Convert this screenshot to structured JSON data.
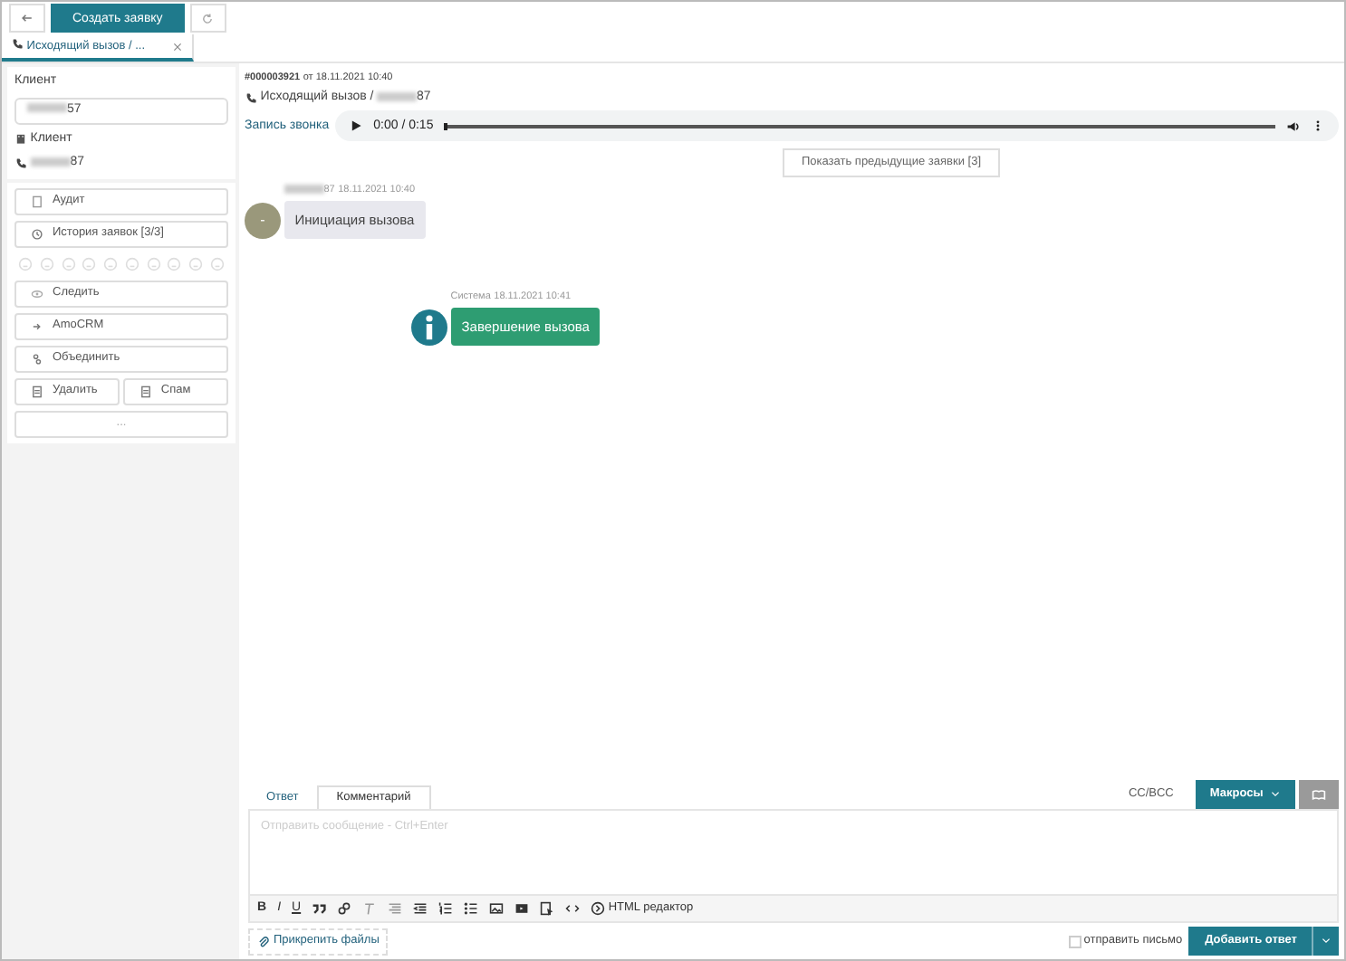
{
  "top_bar": {
    "create_button": "Создать заявку"
  },
  "tabs": [
    {
      "label": "Исходящий вызов / ...",
      "selected": true
    }
  ],
  "client": {
    "title": "Клиент",
    "phone_field": "57",
    "type": "Клиент",
    "phone": "87"
  },
  "actions": [
    {
      "label": "Аудит"
    },
    {
      "label": "История заявок [3/3]"
    }
  ],
  "actions2": [
    {
      "label": "Следить"
    },
    {
      "label": "AmoCRM"
    },
    {
      "label": "Объединить"
    }
  ],
  "split_actions": [
    {
      "label": "Удалить"
    },
    {
      "label": "Спам"
    }
  ],
  "more_button": "...",
  "ticket": {
    "number": "#000003921",
    "date": "от 18.11.2021 10:40",
    "title": "Исходящий вызов /",
    "phone": "87"
  },
  "recording": {
    "label": "Запись звонка",
    "time": "0:00 / 0:15",
    "level": 0
  },
  "previous_button": "Показать предыдущие заявки [3]",
  "messages": [
    {
      "kind": "client",
      "author": "87",
      "time": "18.11.2021 10:40",
      "avatar": "-",
      "text": "Инициация вызова"
    },
    {
      "kind": "system",
      "author": "Система",
      "time": "18.11.2021 10:41",
      "text": "Завершение вызова"
    }
  ],
  "composer": {
    "tabs": [
      {
        "label": "Ответ",
        "selected": false
      },
      {
        "label": "Комментарий",
        "selected": true
      }
    ],
    "format_buttons": [
      "B",
      "I",
      "U"
    ],
    "cc": "CC/BCC",
    "macros": "Макросы",
    "placeholder": "Отправить сообщение - Ctrl+Enter",
    "html_editor": "HTML редактор",
    "attach": "Прикрепить файлы",
    "send_letter": {
      "label": "отправить письмо",
      "checked": false
    },
    "submit": "Добавить ответ"
  }
}
